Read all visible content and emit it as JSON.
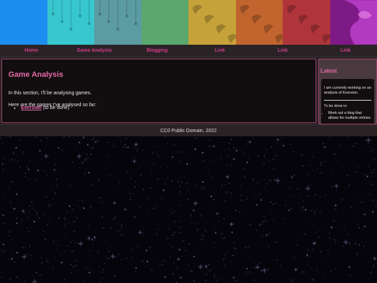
{
  "banner": {
    "stripes": [
      {
        "name": "stripe-blue",
        "color": "#1c8ef0"
      },
      {
        "name": "stripe-cyan",
        "color": "#38c6cf"
      },
      {
        "name": "stripe-teal",
        "color": "#5b9ba2"
      },
      {
        "name": "stripe-green",
        "color": "#5ba86f"
      },
      {
        "name": "stripe-gold",
        "color": "#c7a23a"
      },
      {
        "name": "stripe-orange",
        "color": "#c1642e"
      },
      {
        "name": "stripe-red",
        "color": "#b0353b"
      },
      {
        "name": "stripe-purple",
        "color": "#7d1a86"
      }
    ]
  },
  "nav": {
    "items": [
      "Home",
      "Game Analysis",
      "Blogging",
      "Link",
      "Link",
      "Link"
    ]
  },
  "main": {
    "title": "Game Analysis",
    "intro": "In this section, I'll be analysing games.",
    "list_intro": "Here are the games I've analysed so far:",
    "games": [
      {
        "name": "Eversion",
        "note": " (to be done)"
      }
    ]
  },
  "sidebar": {
    "title": "Latest",
    "status": "I am currently working on an analysis of Eversion.",
    "todo_label": "To be done is:",
    "todo_items": [
      "Work out a blog that allows for multiple entries"
    ]
  },
  "footer": {
    "text": "CC0 Public Domain, 2022"
  },
  "colors": {
    "accent": "#e66aa6",
    "panel": "#2a2326",
    "border": "#9b3f6b"
  }
}
